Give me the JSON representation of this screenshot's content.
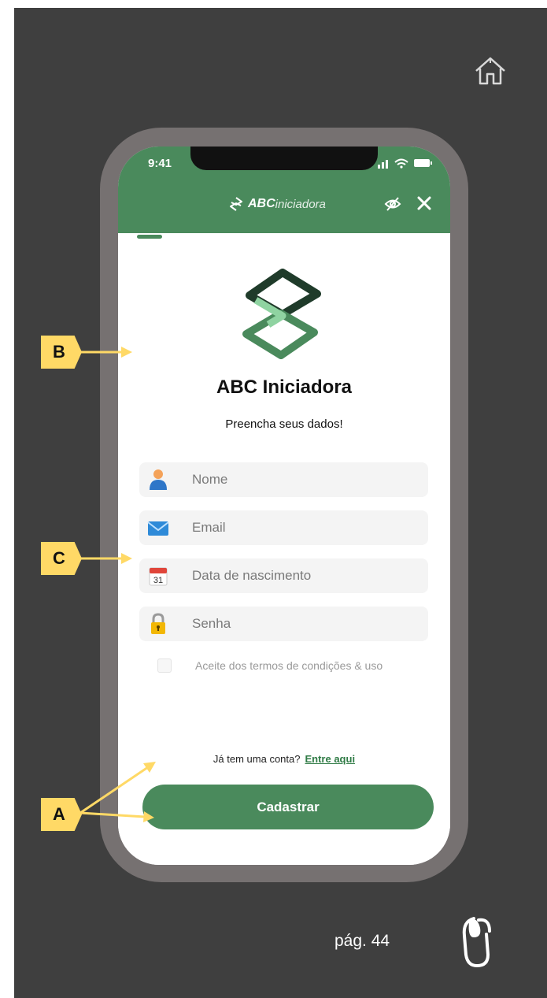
{
  "slide": {
    "background": "#3f3f3f",
    "page_number": "pág. 44"
  },
  "phone": {
    "status_time": "9:41",
    "header_brand_bold": "ABC",
    "header_brand_light": "iniciadora",
    "app_title": "ABC Iniciadora",
    "subtitle": "Preencha seus dados!",
    "fields": [
      {
        "icon": "person-icon",
        "placeholder": "Nome"
      },
      {
        "icon": "envelope-icon",
        "placeholder": "Email"
      },
      {
        "icon": "calendar-icon",
        "calendar_day": "31",
        "placeholder": "Data de nascimento"
      },
      {
        "icon": "lock-icon",
        "placeholder": "Senha"
      }
    ],
    "terms_label": "Aceite dos termos de condições & uso",
    "login_prompt": "Já tem uma conta?",
    "login_link": "Entre aqui",
    "submit_label": "Cadastrar"
  },
  "annotations": [
    "A",
    "B",
    "C"
  ],
  "colors": {
    "brand_green": "#4a8a5c",
    "callout_yellow": "#ffd966",
    "frame_gray": "#767171"
  }
}
